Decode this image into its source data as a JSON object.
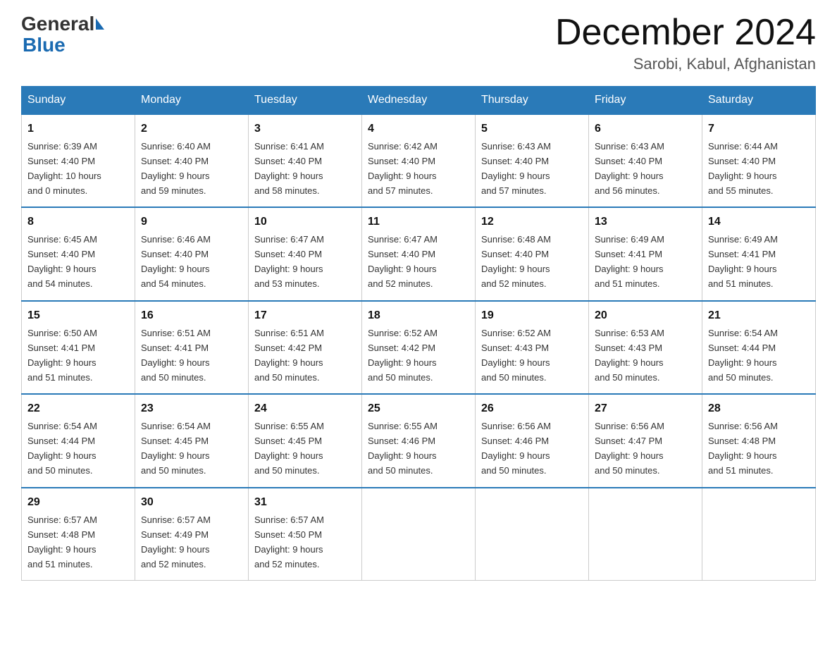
{
  "header": {
    "logo_line1": "General",
    "logo_line2": "Blue",
    "month_title": "December 2024",
    "location": "Sarobi, Kabul, Afghanistan"
  },
  "weekdays": [
    "Sunday",
    "Monday",
    "Tuesday",
    "Wednesday",
    "Thursday",
    "Friday",
    "Saturday"
  ],
  "weeks": [
    [
      {
        "day": "1",
        "sunrise": "6:39 AM",
        "sunset": "4:40 PM",
        "daylight": "10 hours and 0 minutes."
      },
      {
        "day": "2",
        "sunrise": "6:40 AM",
        "sunset": "4:40 PM",
        "daylight": "9 hours and 59 minutes."
      },
      {
        "day": "3",
        "sunrise": "6:41 AM",
        "sunset": "4:40 PM",
        "daylight": "9 hours and 58 minutes."
      },
      {
        "day": "4",
        "sunrise": "6:42 AM",
        "sunset": "4:40 PM",
        "daylight": "9 hours and 57 minutes."
      },
      {
        "day": "5",
        "sunrise": "6:43 AM",
        "sunset": "4:40 PM",
        "daylight": "9 hours and 57 minutes."
      },
      {
        "day": "6",
        "sunrise": "6:43 AM",
        "sunset": "4:40 PM",
        "daylight": "9 hours and 56 minutes."
      },
      {
        "day": "7",
        "sunrise": "6:44 AM",
        "sunset": "4:40 PM",
        "daylight": "9 hours and 55 minutes."
      }
    ],
    [
      {
        "day": "8",
        "sunrise": "6:45 AM",
        "sunset": "4:40 PM",
        "daylight": "9 hours and 54 minutes."
      },
      {
        "day": "9",
        "sunrise": "6:46 AM",
        "sunset": "4:40 PM",
        "daylight": "9 hours and 54 minutes."
      },
      {
        "day": "10",
        "sunrise": "6:47 AM",
        "sunset": "4:40 PM",
        "daylight": "9 hours and 53 minutes."
      },
      {
        "day": "11",
        "sunrise": "6:47 AM",
        "sunset": "4:40 PM",
        "daylight": "9 hours and 52 minutes."
      },
      {
        "day": "12",
        "sunrise": "6:48 AM",
        "sunset": "4:40 PM",
        "daylight": "9 hours and 52 minutes."
      },
      {
        "day": "13",
        "sunrise": "6:49 AM",
        "sunset": "4:41 PM",
        "daylight": "9 hours and 51 minutes."
      },
      {
        "day": "14",
        "sunrise": "6:49 AM",
        "sunset": "4:41 PM",
        "daylight": "9 hours and 51 minutes."
      }
    ],
    [
      {
        "day": "15",
        "sunrise": "6:50 AM",
        "sunset": "4:41 PM",
        "daylight": "9 hours and 51 minutes."
      },
      {
        "day": "16",
        "sunrise": "6:51 AM",
        "sunset": "4:41 PM",
        "daylight": "9 hours and 50 minutes."
      },
      {
        "day": "17",
        "sunrise": "6:51 AM",
        "sunset": "4:42 PM",
        "daylight": "9 hours and 50 minutes."
      },
      {
        "day": "18",
        "sunrise": "6:52 AM",
        "sunset": "4:42 PM",
        "daylight": "9 hours and 50 minutes."
      },
      {
        "day": "19",
        "sunrise": "6:52 AM",
        "sunset": "4:43 PM",
        "daylight": "9 hours and 50 minutes."
      },
      {
        "day": "20",
        "sunrise": "6:53 AM",
        "sunset": "4:43 PM",
        "daylight": "9 hours and 50 minutes."
      },
      {
        "day": "21",
        "sunrise": "6:54 AM",
        "sunset": "4:44 PM",
        "daylight": "9 hours and 50 minutes."
      }
    ],
    [
      {
        "day": "22",
        "sunrise": "6:54 AM",
        "sunset": "4:44 PM",
        "daylight": "9 hours and 50 minutes."
      },
      {
        "day": "23",
        "sunrise": "6:54 AM",
        "sunset": "4:45 PM",
        "daylight": "9 hours and 50 minutes."
      },
      {
        "day": "24",
        "sunrise": "6:55 AM",
        "sunset": "4:45 PM",
        "daylight": "9 hours and 50 minutes."
      },
      {
        "day": "25",
        "sunrise": "6:55 AM",
        "sunset": "4:46 PM",
        "daylight": "9 hours and 50 minutes."
      },
      {
        "day": "26",
        "sunrise": "6:56 AM",
        "sunset": "4:46 PM",
        "daylight": "9 hours and 50 minutes."
      },
      {
        "day": "27",
        "sunrise": "6:56 AM",
        "sunset": "4:47 PM",
        "daylight": "9 hours and 50 minutes."
      },
      {
        "day": "28",
        "sunrise": "6:56 AM",
        "sunset": "4:48 PM",
        "daylight": "9 hours and 51 minutes."
      }
    ],
    [
      {
        "day": "29",
        "sunrise": "6:57 AM",
        "sunset": "4:48 PM",
        "daylight": "9 hours and 51 minutes."
      },
      {
        "day": "30",
        "sunrise": "6:57 AM",
        "sunset": "4:49 PM",
        "daylight": "9 hours and 52 minutes."
      },
      {
        "day": "31",
        "sunrise": "6:57 AM",
        "sunset": "4:50 PM",
        "daylight": "9 hours and 52 minutes."
      },
      null,
      null,
      null,
      null
    ]
  ],
  "labels": {
    "sunrise": "Sunrise:",
    "sunset": "Sunset:",
    "daylight": "Daylight:"
  }
}
